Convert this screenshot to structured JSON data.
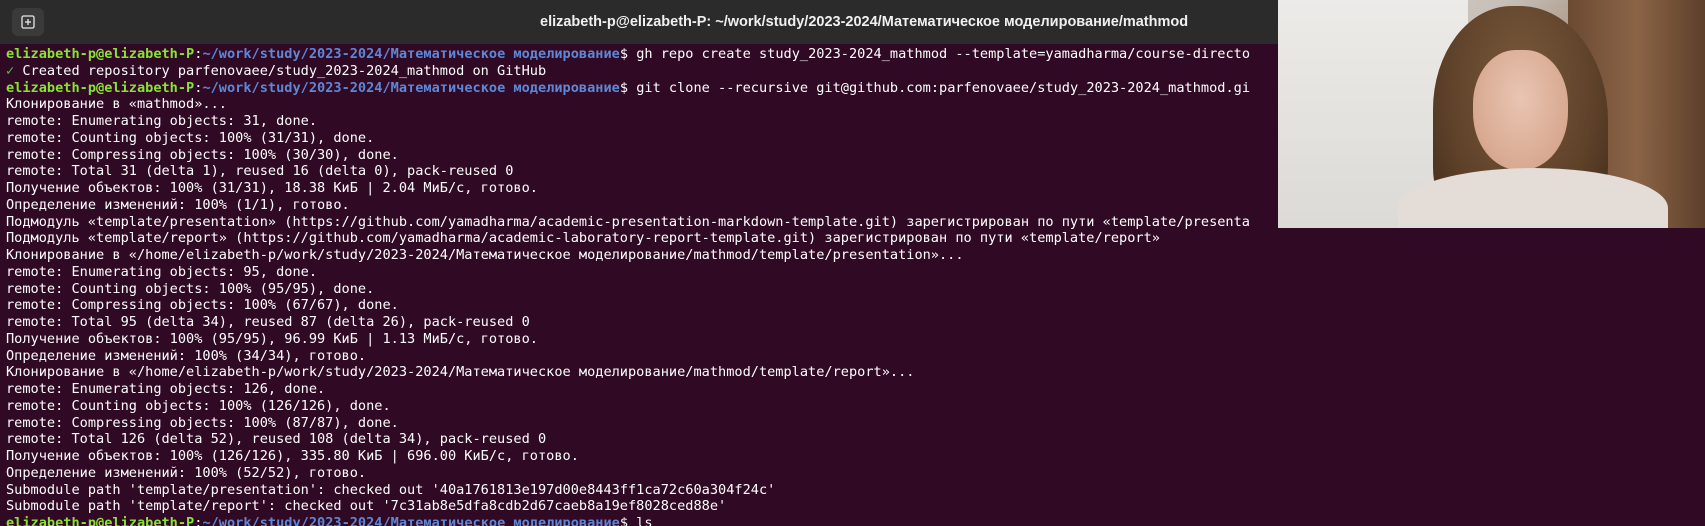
{
  "window": {
    "title": "elizabeth-p@elizabeth-P: ~/work/study/2023-2024/Математическое моделирование/mathmod",
    "new_tab_icon": "new-tab-icon"
  },
  "colors": {
    "background": "#300a24",
    "titlebar": "#2b2b2b",
    "prompt_user": "#8ae234",
    "prompt_path": "#5f87d7",
    "text": "#ffffff"
  },
  "terminal": {
    "lines": [
      {
        "user": "elizabeth-p@elizabeth-P",
        "sep": ":",
        "path": "~/work/study/2023-2024/Математическое моделирование",
        "cmd": "$ gh repo create study_2023-2024_mathmod --template=yamadharma/course-directo"
      },
      {
        "check": "✓",
        "text": " Created repository parfenovaee/study_2023-2024_mathmod on GitHub"
      },
      {
        "user": "elizabeth-p@elizabeth-P",
        "sep": ":",
        "path": "~/work/study/2023-2024/Математическое моделирование",
        "cmd": "$ git clone --recursive git@github.com:parfenovaee/study_2023-2024_mathmod.gi"
      },
      {
        "text": "Клонирование в «mathmod»..."
      },
      {
        "text": "remote: Enumerating objects: 31, done."
      },
      {
        "text": "remote: Counting objects: 100% (31/31), done."
      },
      {
        "text": "remote: Compressing objects: 100% (30/30), done."
      },
      {
        "text": "remote: Total 31 (delta 1), reused 16 (delta 0), pack-reused 0"
      },
      {
        "text": "Получение объектов: 100% (31/31), 18.38 КиБ | 2.04 МиБ/с, готово."
      },
      {
        "text": "Определение изменений: 100% (1/1), готово."
      },
      {
        "text": "Подмодуль «template/presentation» (https://github.com/yamadharma/academic-presentation-markdown-template.git) зарегистрирован по пути «template/presenta"
      },
      {
        "text": "Подмодуль «template/report» (https://github.com/yamadharma/academic-laboratory-report-template.git) зарегистрирован по пути «template/report»"
      },
      {
        "text": "Клонирование в «/home/elizabeth-p/work/study/2023-2024/Математическое моделирование/mathmod/template/presentation»..."
      },
      {
        "text": "remote: Enumerating objects: 95, done."
      },
      {
        "text": "remote: Counting objects: 100% (95/95), done."
      },
      {
        "text": "remote: Compressing objects: 100% (67/67), done."
      },
      {
        "text": "remote: Total 95 (delta 34), reused 87 (delta 26), pack-reused 0"
      },
      {
        "text": "Получение объектов: 100% (95/95), 96.99 КиБ | 1.13 МиБ/с, готово."
      },
      {
        "text": "Определение изменений: 100% (34/34), готово."
      },
      {
        "text": "Клонирование в «/home/elizabeth-p/work/study/2023-2024/Математическое моделирование/mathmod/template/report»..."
      },
      {
        "text": "remote: Enumerating objects: 126, done."
      },
      {
        "text": "remote: Counting objects: 100% (126/126), done."
      },
      {
        "text": "remote: Compressing objects: 100% (87/87), done."
      },
      {
        "text": "remote: Total 126 (delta 52), reused 108 (delta 34), pack-reused 0"
      },
      {
        "text": "Получение объектов: 100% (126/126), 335.80 КиБ | 696.00 КиБ/с, готово."
      },
      {
        "text": "Определение изменений: 100% (52/52), готово."
      },
      {
        "text": "Submodule path 'template/presentation': checked out '40a1761813e197d00e8443ff1ca72c60a304f24c'"
      },
      {
        "text": "Submodule path 'template/report': checked out '7c31ab8e5dfa8cdb2d67caeb8a19ef8028ced88e'"
      },
      {
        "user": "elizabeth-p@elizabeth-P",
        "sep": ":",
        "path": "~/work/study/2023-2024/Математическое моделирование",
        "cmd": "$ ls"
      }
    ]
  }
}
